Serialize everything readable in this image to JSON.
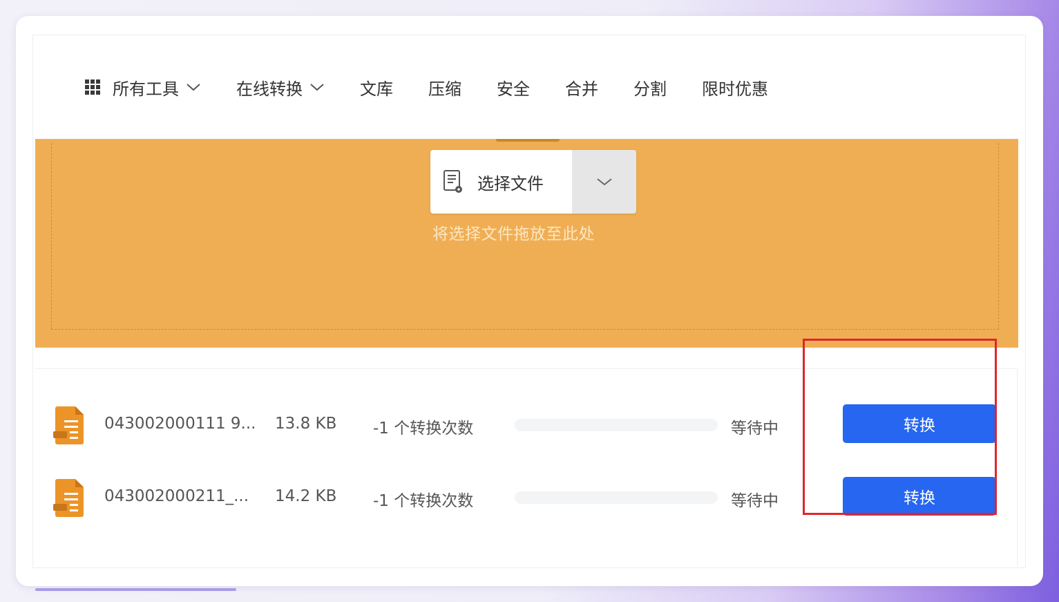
{
  "nav": {
    "all_tools": "所有工具",
    "online_convert": "在线转换",
    "library": "文库",
    "compress": "压缩",
    "security": "安全",
    "merge": "合并",
    "split": "分割",
    "offer": "限时优惠"
  },
  "uploader": {
    "select_label": "选择文件",
    "drop_hint": "将选择文件拖放至此处"
  },
  "files": [
    {
      "name": "043002000111 9...",
      "size": "13.8 KB",
      "count": "-1 个转换次数",
      "status": "等待中",
      "action": "转换",
      "progress": 0
    },
    {
      "name": "043002000211_...",
      "size": "14.2 KB",
      "count": "-1 个转换次数",
      "status": "等待中",
      "action": "转换",
      "progress": 0
    }
  ],
  "colors": {
    "accent_orange": "#f0ae54",
    "button_blue": "#2666f0",
    "highlight_red": "#e0242b"
  }
}
